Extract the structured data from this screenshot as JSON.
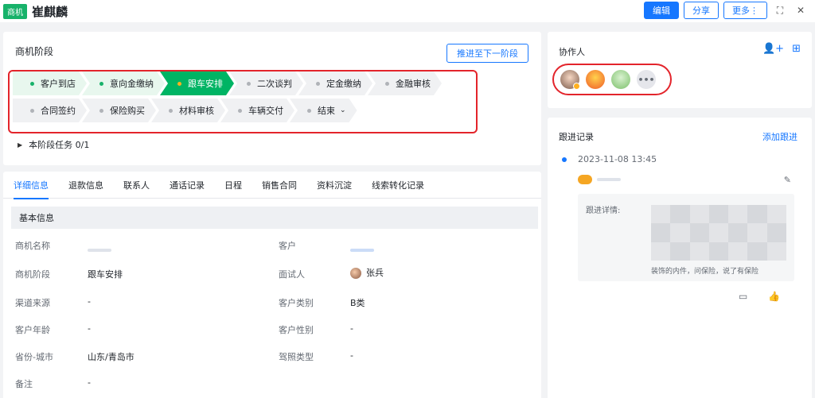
{
  "header": {
    "tag": "商机",
    "name": "崔麒麟",
    "edit_label": "编辑",
    "share_label": "分享",
    "more_label": "更多⋮"
  },
  "stage_panel": {
    "title": "商机阶段",
    "advance_label": "推进至下一阶段",
    "row1": [
      {
        "label": "客户到店",
        "state": "done"
      },
      {
        "label": "意向金缴纳",
        "state": "done"
      },
      {
        "label": "跟车安排",
        "state": "current"
      },
      {
        "label": "二次谈判",
        "state": "todo"
      },
      {
        "label": "定金缴纳",
        "state": "todo"
      },
      {
        "label": "金融审核",
        "state": "todo"
      }
    ],
    "row2": [
      {
        "label": "合同签约",
        "state": "todo"
      },
      {
        "label": "保险购买",
        "state": "todo"
      },
      {
        "label": "材料审核",
        "state": "todo"
      },
      {
        "label": "车辆交付",
        "state": "todo"
      },
      {
        "label": "结束",
        "state": "todo"
      }
    ],
    "task_label": "本阶段任务 0/1"
  },
  "detail": {
    "tabs": [
      "详细信息",
      "退款信息",
      "联系人",
      "通话记录",
      "日程",
      "销售合同",
      "资料沉淀",
      "线索转化记录"
    ],
    "section": "基本信息",
    "fields": {
      "opp_name_label": "商机名称",
      "customer_label": "客户",
      "stage_label": "商机阶段",
      "stage_value": "跟车安排",
      "interviewer_label": "面试人",
      "interviewer_value": "张兵",
      "channel_label": "渠道来源",
      "channel_value": "-",
      "ctype_label": "客户类别",
      "ctype_value": "B类",
      "age_label": "客户年龄",
      "age_value": "-",
      "gender_label": "客户性别",
      "gender_value": "-",
      "region_label": "省份-城市",
      "region_value": "山东/青岛市",
      "license_label": "驾照类型",
      "license_value": "-",
      "note_label": "备注",
      "note_value": "-"
    }
  },
  "collab": {
    "title": "协作人"
  },
  "followup": {
    "title": "跟进记录",
    "add_label": "添加跟进",
    "time": "2023-11-08 13:45",
    "detail_label": "跟进详情:",
    "tail_text": "装饰的内件，问保险，说了有保险"
  }
}
